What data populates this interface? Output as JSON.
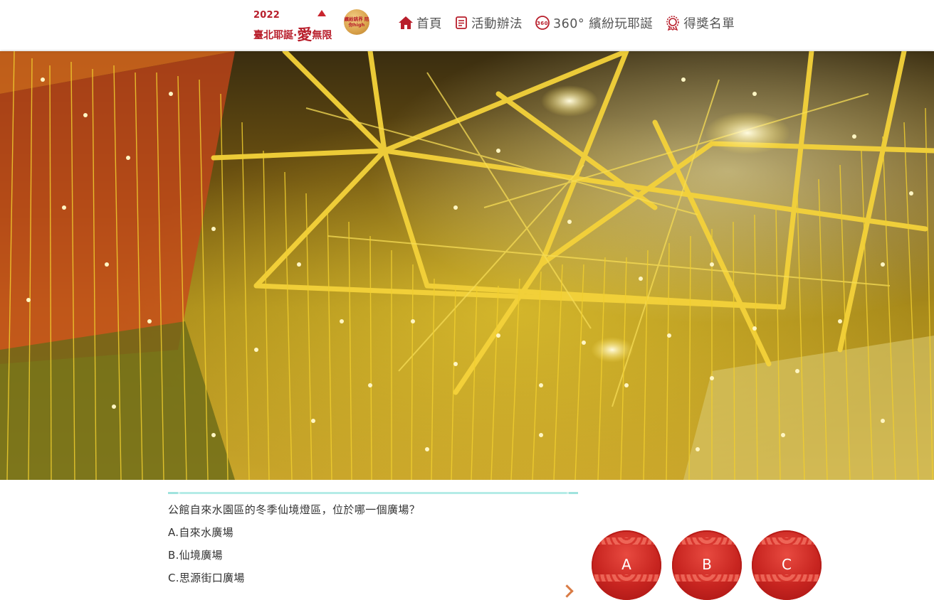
{
  "header": {
    "logo": {
      "year": "2022",
      "title_left": "臺北耶誕",
      "title_dot": "·",
      "title_love": "愛",
      "title_right": "無限",
      "badge": "繽紛跳界 陪你high"
    },
    "nav": [
      {
        "label": "首頁",
        "icon": "home-icon"
      },
      {
        "label": "活動辦法",
        "icon": "document-icon"
      },
      {
        "label": "360°  繽紛玩耶誕",
        "icon": "360-icon"
      },
      {
        "label": "得獎名單",
        "icon": "award-icon"
      }
    ]
  },
  "hero": {
    "image": "string-lights-tunnel-photo"
  },
  "quiz": {
    "question": "公館自來水園區的冬季仙境燈區，位於哪一個廣場？",
    "options": [
      "A.自來水廣場",
      "B.仙境廣場",
      "C.思源街口廣場"
    ],
    "answers": [
      "A",
      "B",
      "C"
    ]
  },
  "colors": {
    "brand_red": "#b81e2b",
    "nav_text": "#555555",
    "answer_ball": "#c82520",
    "divider": "#9fe3de"
  }
}
